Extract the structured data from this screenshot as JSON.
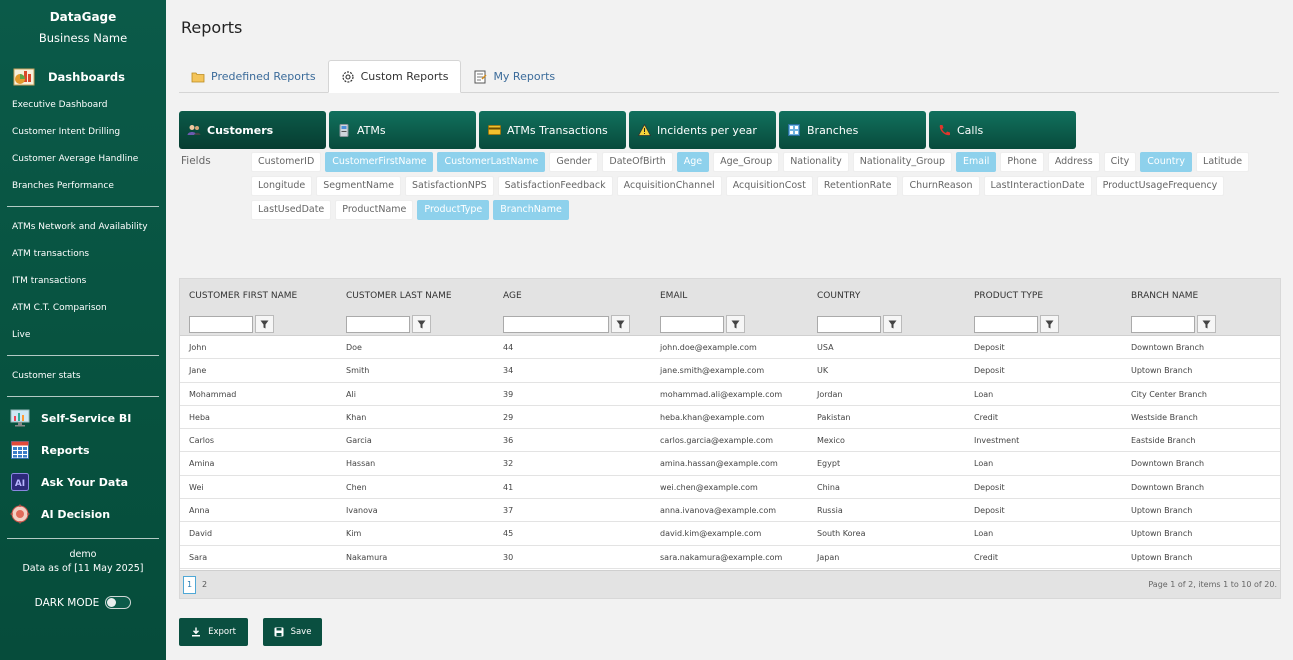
{
  "sidebar": {
    "brand": "DataGage",
    "business": "Business Name",
    "dashboards_label": "Dashboards",
    "group1": [
      "Executive Dashboard",
      "Customer Intent Drilling",
      "Customer Average Handline",
      "Branches Performance"
    ],
    "group2": [
      "ATMs Network and Availability",
      "ATM transactions",
      "ITM transactions",
      "ATM C.T. Comparison",
      "Live"
    ],
    "group3": [
      "Customer stats"
    ],
    "bi": [
      {
        "label": "Self-Service BI",
        "icon": "monitor-chart-icon"
      },
      {
        "label": "Reports",
        "icon": "grid-icon"
      },
      {
        "label": "Ask Your Data",
        "icon": "ai-icon"
      },
      {
        "label": "AI Decision",
        "icon": "brain-icon"
      }
    ],
    "user": "demo",
    "data_as_of": "Data as of [11 May 2025]",
    "dark_mode": "DARK MODE"
  },
  "page": {
    "title": "Reports",
    "tabs": [
      {
        "label": "Predefined Reports",
        "icon": "folder-icon"
      },
      {
        "label": "Custom Reports",
        "icon": "gear-icon"
      },
      {
        "label": "My Reports",
        "icon": "notepad-icon"
      }
    ],
    "entities": [
      {
        "label": "Customers",
        "icon": "users-icon"
      },
      {
        "label": "ATMs",
        "icon": "atm-icon"
      },
      {
        "label": "ATMs Transactions",
        "icon": "card-icon"
      },
      {
        "label": "Incidents per year",
        "icon": "warning-icon"
      },
      {
        "label": "Branches",
        "icon": "building-icon"
      },
      {
        "label": "Calls",
        "icon": "phone-icon"
      }
    ],
    "fields_label": "Fields",
    "fields": [
      {
        "name": "CustomerID",
        "selected": false
      },
      {
        "name": "CustomerFirstName",
        "selected": true
      },
      {
        "name": "CustomerLastName",
        "selected": true
      },
      {
        "name": "Gender",
        "selected": false
      },
      {
        "name": "DateOfBirth",
        "selected": false
      },
      {
        "name": "Age",
        "selected": true
      },
      {
        "name": "Age_Group",
        "selected": false
      },
      {
        "name": "Nationality",
        "selected": false
      },
      {
        "name": "Nationality_Group",
        "selected": false
      },
      {
        "name": "Email",
        "selected": true
      },
      {
        "name": "Phone",
        "selected": false
      },
      {
        "name": "Address",
        "selected": false
      },
      {
        "name": "City",
        "selected": false
      },
      {
        "name": "Country",
        "selected": true
      },
      {
        "name": "Latitude",
        "selected": false
      },
      {
        "name": "Longitude",
        "selected": false
      },
      {
        "name": "SegmentName",
        "selected": false
      },
      {
        "name": "SatisfactionNPS",
        "selected": false
      },
      {
        "name": "SatisfactionFeedback",
        "selected": false
      },
      {
        "name": "AcquisitionChannel",
        "selected": false
      },
      {
        "name": "AcquisitionCost",
        "selected": false
      },
      {
        "name": "RetentionRate",
        "selected": false
      },
      {
        "name": "ChurnReason",
        "selected": false
      },
      {
        "name": "LastInteractionDate",
        "selected": false
      },
      {
        "name": "ProductUsageFrequency",
        "selected": false
      },
      {
        "name": "LastUsedDate",
        "selected": false
      },
      {
        "name": "ProductName",
        "selected": false
      },
      {
        "name": "ProductType",
        "selected": true
      },
      {
        "name": "BranchName",
        "selected": true
      }
    ],
    "columns": [
      "CUSTOMER FIRST NAME",
      "CUSTOMER LAST NAME",
      "AGE",
      "EMAIL",
      "COUNTRY",
      "PRODUCT TYPE",
      "BRANCH NAME"
    ],
    "rows": [
      [
        "John",
        "Doe",
        "44",
        "john.doe@example.com",
        "USA",
        "Deposit",
        "Downtown Branch"
      ],
      [
        "Jane",
        "Smith",
        "34",
        "jane.smith@example.com",
        "UK",
        "Deposit",
        "Uptown Branch"
      ],
      [
        "Mohammad",
        "Ali",
        "39",
        "mohammad.ali@example.com",
        "Jordan",
        "Loan",
        "City Center Branch"
      ],
      [
        "Heba",
        "Khan",
        "29",
        "heba.khan@example.com",
        "Pakistan",
        "Credit",
        "Westside Branch"
      ],
      [
        "Carlos",
        "Garcia",
        "36",
        "carlos.garcia@example.com",
        "Mexico",
        "Investment",
        "Eastside Branch"
      ],
      [
        "Amina",
        "Hassan",
        "32",
        "amina.hassan@example.com",
        "Egypt",
        "Loan",
        "Downtown Branch"
      ],
      [
        "Wei",
        "Chen",
        "41",
        "wei.chen@example.com",
        "China",
        "Deposit",
        "Downtown Branch"
      ],
      [
        "Anna",
        "Ivanova",
        "37",
        "anna.ivanova@example.com",
        "Russia",
        "Deposit",
        "Uptown Branch"
      ],
      [
        "David",
        "Kim",
        "45",
        "david.kim@example.com",
        "South Korea",
        "Loan",
        "Uptown Branch"
      ],
      [
        "Sara",
        "Nakamura",
        "30",
        "sara.nakamura@example.com",
        "Japan",
        "Credit",
        "Uptown Branch"
      ]
    ],
    "pages": [
      "1",
      "2"
    ],
    "page_info": "Page 1 of 2, items 1 to 10 of 20.",
    "export_label": "Export",
    "save_label": "Save"
  }
}
